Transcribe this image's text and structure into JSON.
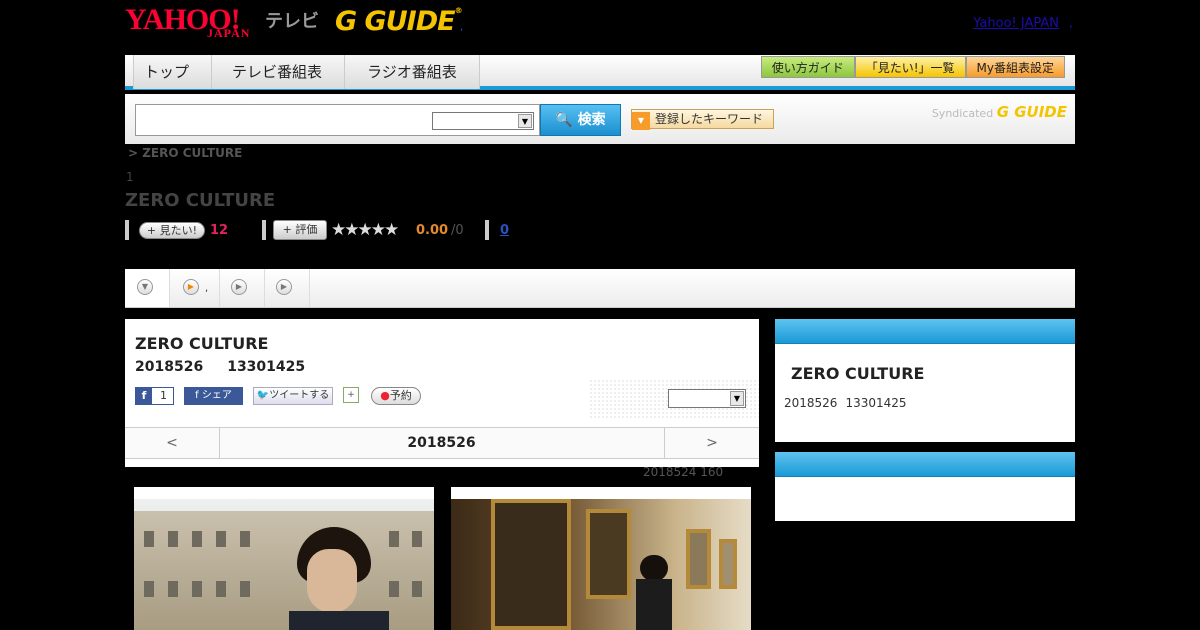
{
  "header": {
    "yahoo_logo": "YAHOO!",
    "japan_logo": "JAPAN",
    "tv_label": "テレビ",
    "gguide_logo": "G GUIDE",
    "gguide_reg": "®",
    "dot": ",",
    "yahoo_japan_link": "Yahoo! JAPAN",
    "link_dot": ","
  },
  "nav": {
    "tabs": [
      "トップ",
      "テレビ番組表",
      "ラジオ番組表"
    ],
    "side_buttons": [
      "使い方ガイド",
      "「見たい!」一覧",
      "My番組表設定"
    ]
  },
  "search": {
    "button_label": "検索",
    "keyword_button": "登録したキーワード",
    "syndicated": "Syndicated",
    "syndicated_logo": "G GUIDE"
  },
  "program": {
    "breadcrumb": "> ZERO CULTURE",
    "genre_num": "1",
    "title": "ZERO CULTURE",
    "mitai_label": "見たい!",
    "mitai_count": "12",
    "rate_label": "評価",
    "stars": "★★★★★",
    "rating": "0.00",
    "rating_max": "/0",
    "review_count": "0"
  },
  "card": {
    "title": "ZERO CULTURE",
    "date": "2018526",
    "time": "13301425",
    "fb_like_count": "1",
    "fb_share": "シェア",
    "tweet": "ツイートする",
    "reserve": "予約",
    "prev": "<",
    "nav_date": "2018526",
    "next": ">"
  },
  "photo_caption": "2018524  160",
  "side": {
    "title": "ZERO CULTURE",
    "date": "2018526",
    "time": "13301425"
  },
  "colors": {
    "accent_blue": "#1a9ad6",
    "yahoo_red": "#ff0033",
    "gguide_yellow": "#f5c400"
  }
}
